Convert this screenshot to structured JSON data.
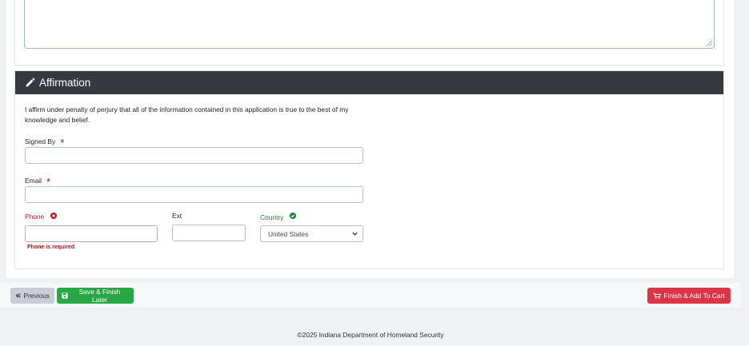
{
  "affirmation": {
    "title": "Affirmation",
    "statement": "I affirm under penalty of perjury that all of the information contained in this application is true to the best of my knowledge and belief.",
    "signed_by_label": "Signed By",
    "signed_by_value": "",
    "email_label": "Email",
    "email_value": "",
    "phone_label": "Phone",
    "phone_value": "",
    "phone_error": "Phone is required",
    "ext_label": "Ext",
    "ext_value": "",
    "country_label": "Country",
    "country_selected": "United States",
    "required_marker": "*"
  },
  "actions": {
    "previous_label": "Previous",
    "save_label": "Save & Finish Later",
    "finish_label": "Finish & Add To Cart"
  },
  "footer": {
    "copyright": "©2025 Indiana Department of Homeland Security"
  },
  "colors": {
    "header_bg": "#343a40",
    "required": "#c0121f",
    "valid": "#1e7e34",
    "save_btn": "#28a745",
    "finish_btn": "#dc3545",
    "prev_btn": "#c9cdd5"
  }
}
